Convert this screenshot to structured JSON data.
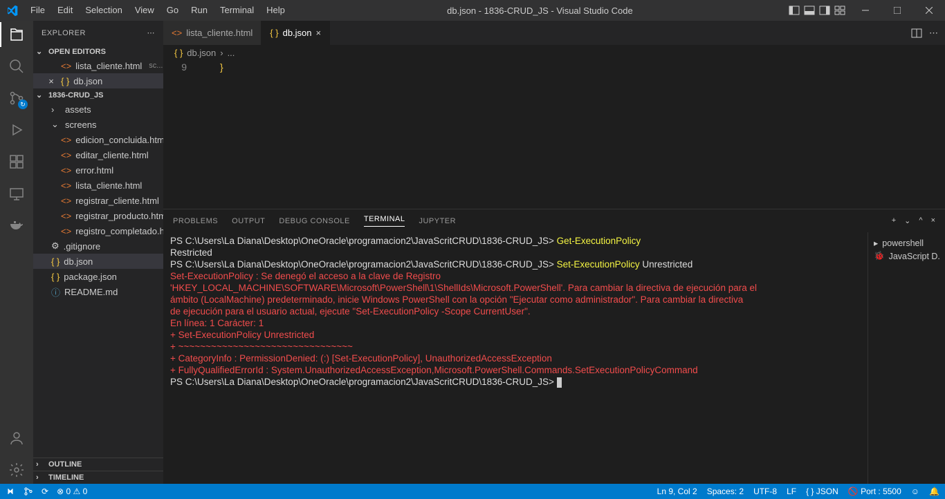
{
  "title": "db.json - 1836-CRUD_JS - Visual Studio Code",
  "menu": [
    "File",
    "Edit",
    "Selection",
    "View",
    "Go",
    "Run",
    "Terminal",
    "Help"
  ],
  "explorer": {
    "title": "EXPLORER",
    "openEditors": "OPEN EDITORS",
    "project": "1836-CRUD_JS",
    "outline": "OUTLINE",
    "timeline": "TIMELINE",
    "openEditorsItems": [
      {
        "icon": "html",
        "name": "lista_cliente.html",
        "sub": "sc..."
      },
      {
        "icon": "json",
        "name": "db.json",
        "active": true
      }
    ],
    "tree": [
      {
        "type": "folder",
        "name": "assets",
        "depth": 1,
        "open": false
      },
      {
        "type": "folder",
        "name": "screens",
        "depth": 1,
        "open": true
      },
      {
        "type": "file",
        "icon": "html",
        "name": "edicion_concluida.html",
        "depth": 2
      },
      {
        "type": "file",
        "icon": "html",
        "name": "editar_cliente.html",
        "depth": 2
      },
      {
        "type": "file",
        "icon": "html",
        "name": "error.html",
        "depth": 2
      },
      {
        "type": "file",
        "icon": "html",
        "name": "lista_cliente.html",
        "depth": 2
      },
      {
        "type": "file",
        "icon": "html",
        "name": "registrar_cliente.html",
        "depth": 2
      },
      {
        "type": "file",
        "icon": "html",
        "name": "registrar_producto.html",
        "depth": 2
      },
      {
        "type": "file",
        "icon": "html",
        "name": "registro_completado.ht...",
        "depth": 2
      },
      {
        "type": "file",
        "icon": "git",
        "name": ".gitignore",
        "depth": 1
      },
      {
        "type": "file",
        "icon": "json",
        "name": "db.json",
        "depth": 1,
        "selected": true
      },
      {
        "type": "file",
        "icon": "json",
        "name": "package.json",
        "depth": 1
      },
      {
        "type": "file",
        "icon": "info",
        "name": "README.md",
        "depth": 1
      }
    ]
  },
  "tabs": [
    {
      "icon": "html",
      "name": "lista_cliente.html",
      "active": false
    },
    {
      "icon": "json",
      "name": "db.json",
      "active": true
    }
  ],
  "breadcrumb": {
    "file": "db.json",
    "rest": "..."
  },
  "code": {
    "lineNum": "9",
    "content": "}"
  },
  "panel": {
    "tabs": [
      "PROBLEMS",
      "OUTPUT",
      "DEBUG CONSOLE",
      "TERMINAL",
      "JUPYTER"
    ],
    "active": "TERMINAL",
    "side": [
      {
        "icon": "term",
        "label": "powershell"
      },
      {
        "icon": "bug",
        "label": "JavaScript D..."
      }
    ],
    "lines": [
      {
        "prompt": "PS C:\\Users\\La Diana\\Desktop\\OneOracle\\programacion2\\JavaScritCRUD\\1836-CRUD_JS> ",
        "cmd": "Get-ExecutionPolicy",
        "cls": "term-yellow"
      },
      {
        "out": "Restricted"
      },
      {
        "prompt": "PS C:\\Users\\La Diana\\Desktop\\OneOracle\\programacion2\\JavaScritCRUD\\1836-CRUD_JS> ",
        "cmd": "Set-ExecutionPolicy",
        "cls": "term-yellow",
        "suffix": " Unrestricted"
      },
      {
        "err": "Set-ExecutionPolicy : Se denegó el acceso a la clave de Registro"
      },
      {
        "err": "'HKEY_LOCAL_MACHINE\\SOFTWARE\\Microsoft\\PowerShell\\1\\ShellIds\\Microsoft.PowerShell'. Para cambiar la directiva de ejecución para el"
      },
      {
        "err": "ámbito (LocalMachine) predeterminado, inicie Windows PowerShell con la opción \"Ejecutar como administrador\". Para cambiar la directiva"
      },
      {
        "err": "de ejecución para el usuario actual, ejecute \"Set-ExecutionPolicy -Scope CurrentUser\"."
      },
      {
        "err": "En línea: 1 Carácter: 1"
      },
      {
        "err": "+ Set-ExecutionPolicy Unrestricted"
      },
      {
        "err": "+ ~~~~~~~~~~~~~~~~~~~~~~~~~~~~~~~~"
      },
      {
        "err": "    + CategoryInfo          : PermissionDenied: (:) [Set-ExecutionPolicy], UnauthorizedAccessException"
      },
      {
        "err": "    + FullyQualifiedErrorId : System.UnauthorizedAccessException,Microsoft.PowerShell.Commands.SetExecutionPolicyCommand"
      },
      {
        "prompt": "PS C:\\Users\\La Diana\\Desktop\\OneOracle\\programacion2\\JavaScritCRUD\\1836-CRUD_JS> ",
        "cursor": true
      }
    ]
  },
  "status": {
    "remote": "",
    "branch": "",
    "sync": "",
    "errors": "0",
    "warnings": "0",
    "ln": "Ln 9, Col 2",
    "spaces": "Spaces: 2",
    "enc": "UTF-8",
    "eol": "LF",
    "lang": "JSON",
    "port": "Port : 5500"
  }
}
